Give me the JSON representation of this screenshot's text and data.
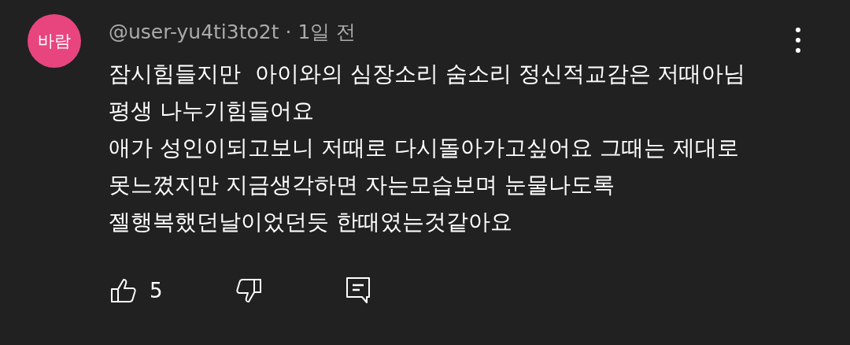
{
  "comment": {
    "avatar_text": "바람",
    "author": "@user-yu4ti3to2t",
    "separator": "·",
    "time": "1일 전",
    "lines": [
      "잠시힘들지만  아이와의 심장소리 숨소리 정신적교감은 저때아님",
      "평생 나누기힘들어요",
      "애가 성인이되고보니 저때로 다시돌아가고싶어요 그때는 제대로",
      "못느꼈지만 지금생각하면 자는모습보며 눈물나도록",
      "젤행복했던날이었던듯 한때였는것같아요"
    ],
    "color": "#e8457f",
    "like_count": "5"
  }
}
